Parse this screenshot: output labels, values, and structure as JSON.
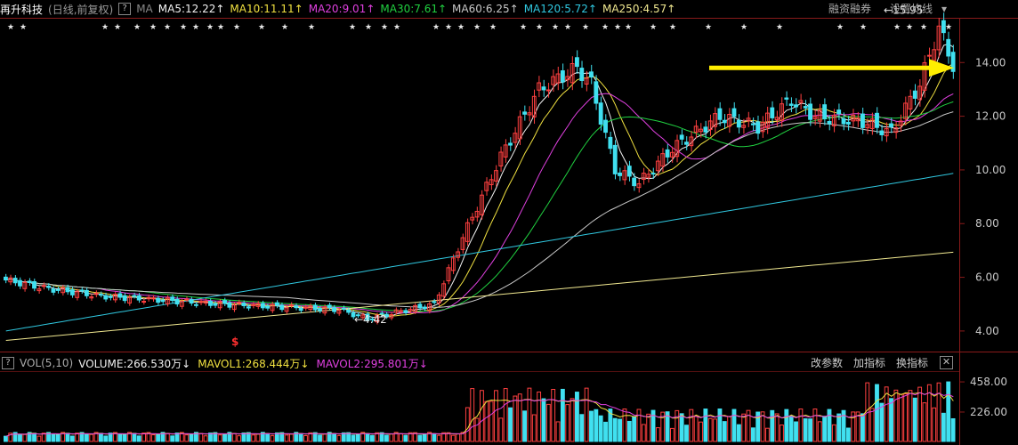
{
  "header": {
    "stock_name": "再升科技",
    "mode": "(日线,前复权)",
    "help": "?",
    "ma_label": "MA",
    "ma_values": [
      {
        "text": "MA5:12.22",
        "arrow": "↑",
        "color": "#f2f2f2"
      },
      {
        "text": "MA10:11.11",
        "arrow": "↑",
        "color": "#f0e040"
      },
      {
        "text": "MA20:9.01",
        "arrow": "↑",
        "color": "#e040e0"
      },
      {
        "text": "MA30:7.61",
        "arrow": "↑",
        "color": "#20d040"
      },
      {
        "text": "MA60:6.25",
        "arrow": "↑",
        "color": "#c8c8c8"
      },
      {
        "text": "MA120:5.72",
        "arrow": "↑",
        "color": "#30c8e0"
      },
      {
        "text": "MA250:4.57",
        "arrow": "↑",
        "color": "#f0e890"
      }
    ],
    "buttons": [
      "融资融券",
      "设置均线"
    ],
    "dropdown": "▾"
  },
  "volume_header": {
    "icon": "?",
    "label": "VOL(5,10)",
    "values": [
      {
        "text": "VOLUME:266.530万",
        "arrow": "↓",
        "color": "#f2f2f2"
      },
      {
        "text": "MAVOL1:268.444万",
        "arrow": "↓",
        "color": "#f0e040"
      },
      {
        "text": "MAVOL2:295.801万",
        "arrow": "↓",
        "color": "#e040e0"
      }
    ],
    "buttons": [
      "改参数",
      "加指标",
      "换指标"
    ],
    "close": "✕"
  },
  "chart_data": [
    {
      "type": "candlestick",
      "price_axis": [
        "14.00",
        "12.00",
        "10.00",
        "8.00",
        "6.00",
        "4.00"
      ],
      "ylim": [
        3.4,
        15.6
      ],
      "annotations": [
        {
          "text": "←15.95",
          "value": 15.95
        },
        {
          "text": "←4.42",
          "value": 4.42
        }
      ],
      "marker_stars": "★",
      "red_marker": "$",
      "highlight_arrow": {
        "color": "#ffee00",
        "level": 13.8
      },
      "colors": {
        "up": "#ff4040",
        "down": "#40e0f0"
      }
    },
    {
      "type": "bar",
      "volume_axis": [
        "458.00",
        "226.00"
      ],
      "ylim": [
        0,
        520
      ]
    }
  ]
}
